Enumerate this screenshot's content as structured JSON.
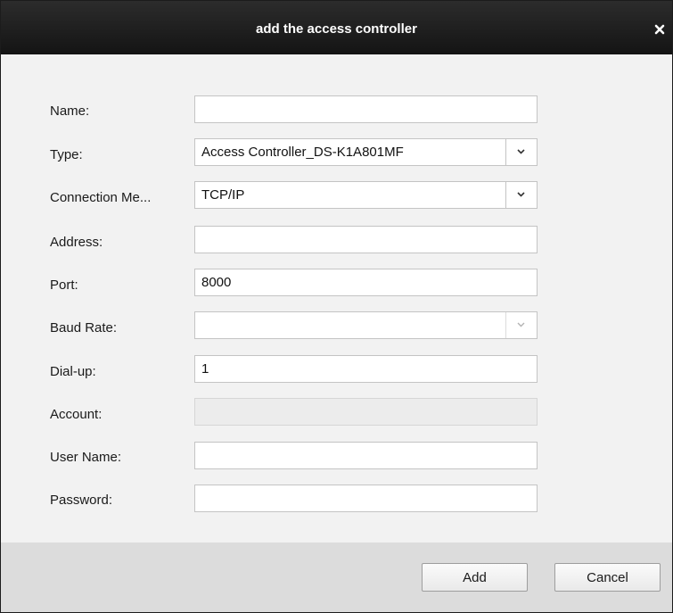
{
  "dialog": {
    "title": "add the access controller"
  },
  "form": {
    "name": {
      "label": "Name:",
      "value": ""
    },
    "type": {
      "label": "Type:",
      "value": "Access Controller_DS-K1A801MF"
    },
    "connection": {
      "label": "Connection Me...",
      "value": "TCP/IP"
    },
    "address": {
      "label": "Address:",
      "value": ""
    },
    "port": {
      "label": "Port:",
      "value": "8000"
    },
    "baud_rate": {
      "label": "Baud Rate:",
      "value": ""
    },
    "dialup": {
      "label": "Dial-up:",
      "value": "1"
    },
    "account": {
      "label": "Account:",
      "value": ""
    },
    "username": {
      "label": "User Name:",
      "value": ""
    },
    "password": {
      "label": "Password:",
      "value": ""
    }
  },
  "buttons": {
    "add": "Add",
    "cancel": "Cancel"
  },
  "icons": {
    "close": "close-icon",
    "dropdown": "chevron-down-icon"
  }
}
